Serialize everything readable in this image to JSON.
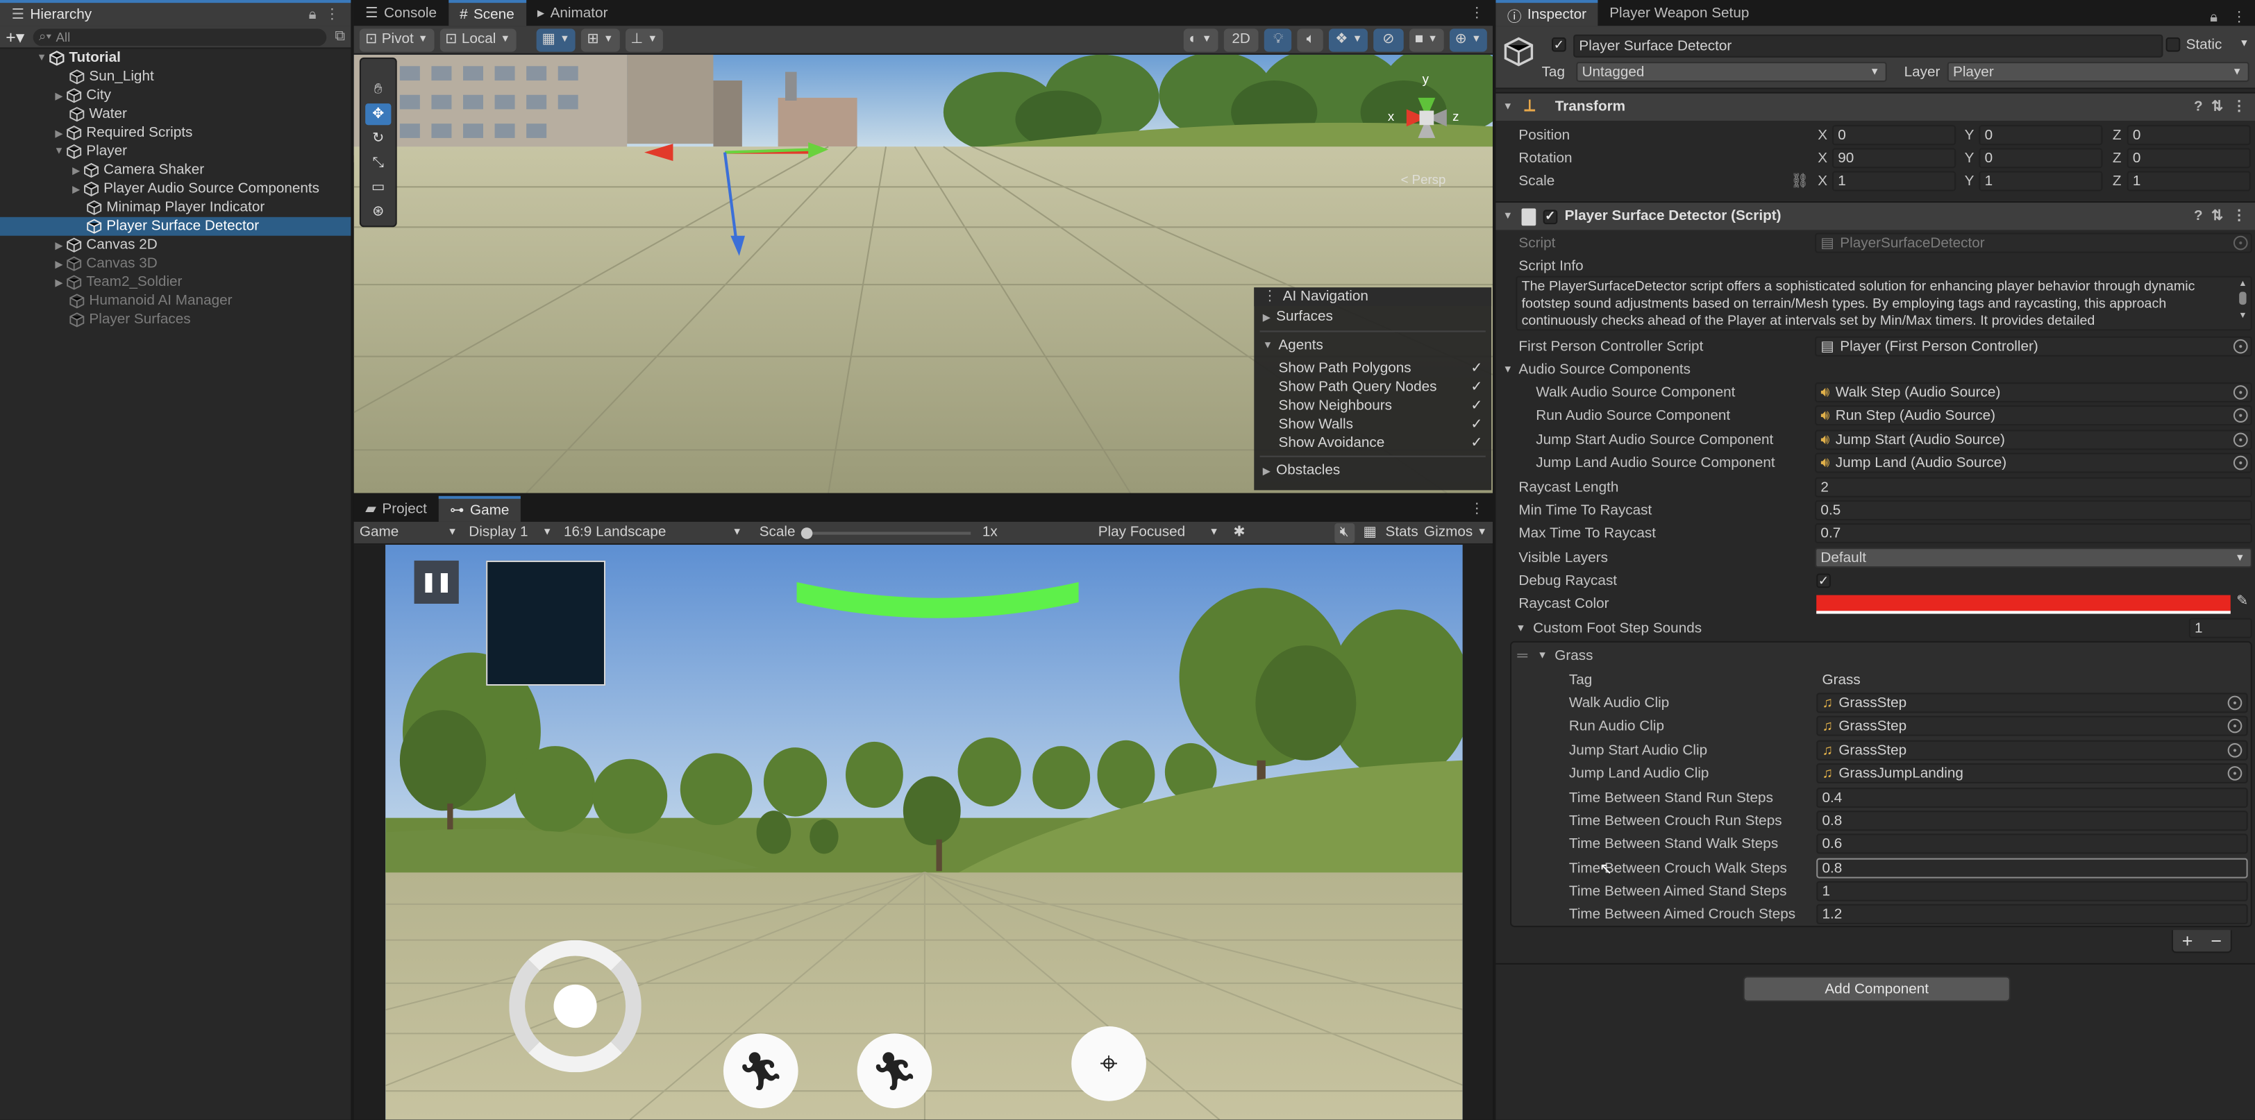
{
  "hierarchy": {
    "tab_label": "Hierarchy",
    "search_placeholder": "All",
    "items": [
      {
        "label": "Tutorial"
      },
      {
        "label": "Sun_Light"
      },
      {
        "label": "City"
      },
      {
        "label": "Water"
      },
      {
        "label": "Required Scripts"
      },
      {
        "label": "Player"
      },
      {
        "label": "Camera Shaker"
      },
      {
        "label": "Player Audio Source Components"
      },
      {
        "label": "Minimap Player Indicator"
      },
      {
        "label": "Player Surface Detector"
      },
      {
        "label": "Canvas 2D"
      },
      {
        "label": "Canvas 3D"
      },
      {
        "label": "Team2_Soldier"
      },
      {
        "label": "Humanoid AI Manager"
      },
      {
        "label": "Player Surfaces"
      }
    ]
  },
  "scene_tabs": {
    "console": "Console",
    "scene": "Scene",
    "animator": "Animator"
  },
  "scene_toolbar": {
    "pivot": "Pivot",
    "local": "Local",
    "mode_2d": "2D"
  },
  "scene_gizmo": {
    "persp": "< Persp",
    "x": "x",
    "y": "y",
    "z": "z"
  },
  "ai_navigation": {
    "title": "AI Navigation",
    "surfaces": "Surfaces",
    "agents": "Agents",
    "options": [
      {
        "label": "Show Path Polygons",
        "checked": "✓"
      },
      {
        "label": "Show Path Query Nodes",
        "checked": "✓"
      },
      {
        "label": "Show Neighbours",
        "checked": "✓"
      },
      {
        "label": "Show Walls",
        "checked": "✓"
      },
      {
        "label": "Show Avoidance",
        "checked": "✓"
      }
    ],
    "obstacles": "Obstacles"
  },
  "game_tabs": {
    "project": "Project",
    "game": "Game"
  },
  "game_toolbar": {
    "view": "Game",
    "display": "Display 1",
    "aspect": "16:9 Landscape",
    "scale_label": "Scale",
    "scale_value": "1x",
    "play_mode": "Play Focused",
    "stats": "Stats",
    "gizmos": "Gizmos"
  },
  "inspector": {
    "tab_label": "Inspector",
    "tab2_label": "Player Weapon Setup",
    "object_name": "Player Surface Detector",
    "static_label": "Static",
    "tag_label": "Tag",
    "tag_value": "Untagged",
    "layer_label": "Layer",
    "layer_value": "Player",
    "transform": {
      "title": "Transform",
      "position_label": "Position",
      "rotation_label": "Rotation",
      "scale_label": "Scale",
      "position": {
        "x": "0",
        "y": "0",
        "z": "0"
      },
      "rotation": {
        "x": "90",
        "y": "0",
        "z": "0"
      },
      "scale": {
        "x": "1",
        "y": "1",
        "z": "1"
      },
      "axis_x": "X",
      "axis_y": "Y",
      "axis_z": "Z"
    },
    "script_component": {
      "title": "Player Surface Detector (Script)",
      "script_label": "Script",
      "script_value": "PlayerSurfaceDetector",
      "info_label": "Script Info",
      "info_text": "The PlayerSurfaceDetector script offers a sophisticated solution for enhancing player behavior through dynamic footstep sound adjustments based on terrain/Mesh types. By employing tags and raycasting, this approach continuously checks ahead of the Player at intervals set by Min/Max timers. It provides detailed",
      "fpc_label": "First Person Controller Script",
      "fpc_value": "Player (First Person Controller)",
      "audio_group_label": "Audio Source Components",
      "audio_sources": [
        {
          "label": "Walk Audio Source Component",
          "value": "Walk Step (Audio Source)"
        },
        {
          "label": "Run Audio Source Component",
          "value": "Run Step (Audio Source)"
        },
        {
          "label": "Jump Start Audio Source Component",
          "value": "Jump Start (Audio Source)"
        },
        {
          "label": "Jump Land Audio Source Component",
          "value": "Jump Land (Audio Source)"
        }
      ],
      "raycast_length_label": "Raycast Length",
      "raycast_length": "2",
      "min_time_label": "Min Time To Raycast",
      "min_time": "0.5",
      "max_time_label": "Max Time To Raycast",
      "max_time": "0.7",
      "visible_layers_label": "Visible Layers",
      "visible_layers": "Default",
      "debug_raycast_label": "Debug Raycast",
      "debug_raycast": "✓",
      "raycast_color_label": "Raycast Color",
      "raycast_color": "#e8261f",
      "custom_sounds_label": "Custom Foot Step Sounds",
      "custom_sounds_count": "1",
      "element_label": "Grass",
      "tag_label": "Tag",
      "tag_value": "Grass",
      "clips": [
        {
          "label": "Walk Audio Clip",
          "value": "GrassStep"
        },
        {
          "label": "Run Audio Clip",
          "value": "GrassStep"
        },
        {
          "label": "Jump Start Audio Clip",
          "value": "GrassStep"
        },
        {
          "label": "Jump Land Audio Clip",
          "value": "GrassJumpLanding"
        }
      ],
      "timings": [
        {
          "label": "Time Between Stand Run Steps",
          "value": "0.4"
        },
        {
          "label": "Time Between Crouch Run Steps",
          "value": "0.8"
        },
        {
          "label": "Time Between Stand Walk Steps",
          "value": "0.6"
        },
        {
          "label": "Time Between Crouch Walk Steps",
          "value": "0.8"
        },
        {
          "label": "Time Between Aimed Stand Steps",
          "value": "1"
        },
        {
          "label": "Time Between Aimed Crouch Steps",
          "value": "1.2"
        }
      ],
      "add_symbol": "+",
      "remove_symbol": "−"
    },
    "add_component_label": "Add Component"
  },
  "colors": {
    "accent": "#2c5d87",
    "selection": "#3a79bb",
    "health_bar": "#5ef04a"
  }
}
